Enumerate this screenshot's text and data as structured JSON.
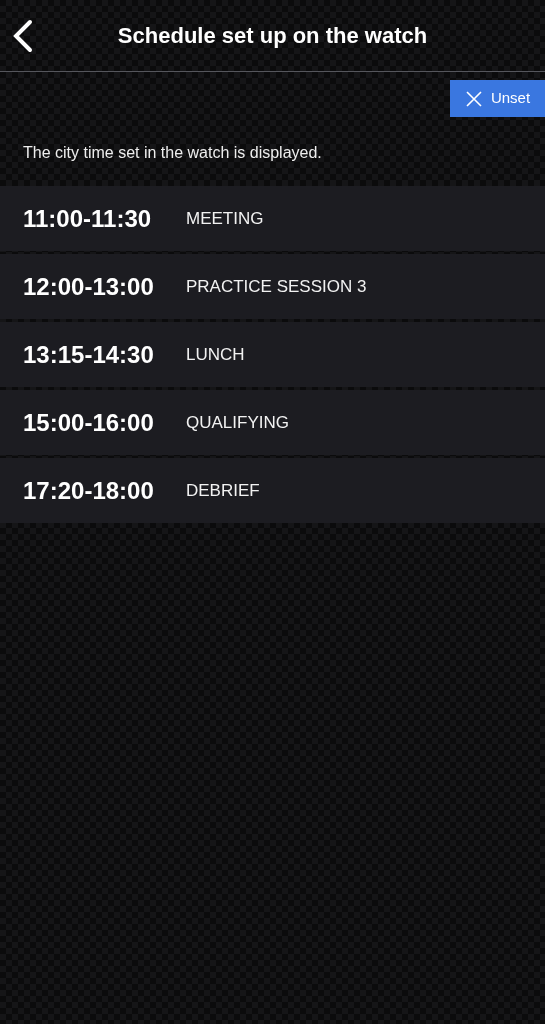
{
  "header": {
    "title": "Schedule set up on the watch"
  },
  "unset_button": {
    "label": "Unset"
  },
  "note": "The city time set in the watch is displayed.",
  "schedule": [
    {
      "time": "11:00-11:30",
      "event": "MEETING"
    },
    {
      "time": "12:00-13:00",
      "event": "PRACTICE SESSION 3"
    },
    {
      "time": "13:15-14:30",
      "event": "LUNCH"
    },
    {
      "time": "15:00-16:00",
      "event": "QUALIFYING"
    },
    {
      "time": "17:20-18:00",
      "event": "DEBRIEF"
    }
  ]
}
